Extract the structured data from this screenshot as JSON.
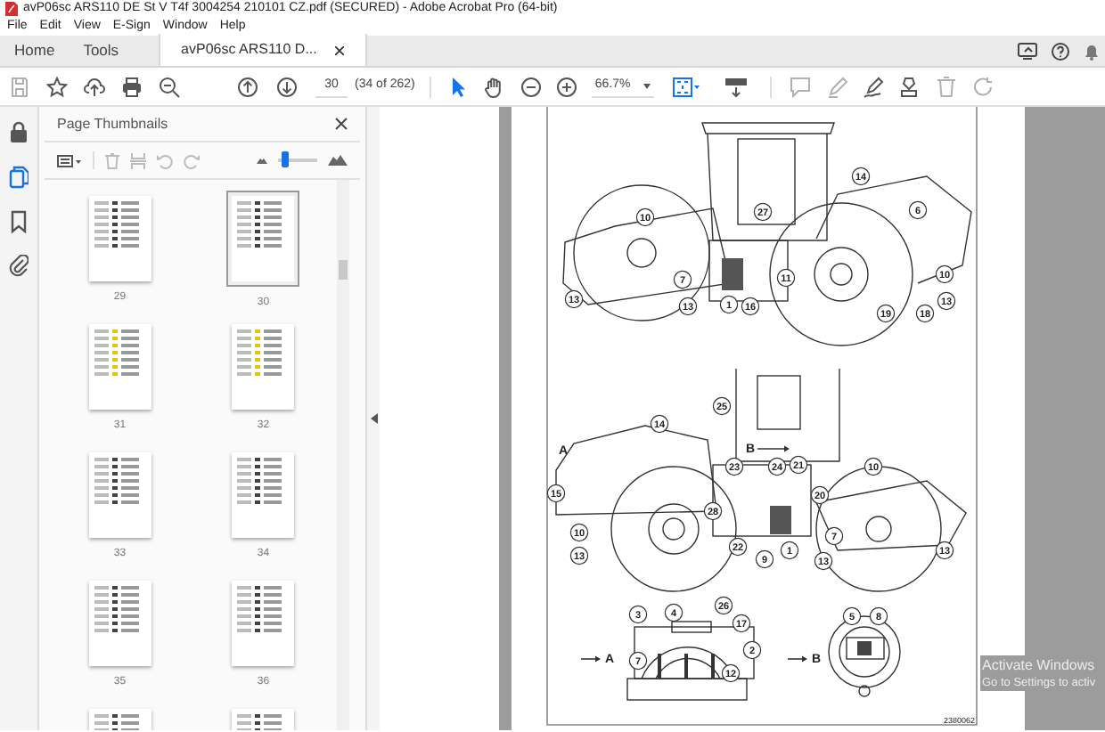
{
  "window": {
    "title": "avP06sc ARS110 DE St V T4f 3004254 210101 CZ.pdf (SECURED) - Adobe Acrobat Pro (64-bit)"
  },
  "menu": [
    "File",
    "Edit",
    "View",
    "E-Sign",
    "Window",
    "Help"
  ],
  "tabs": [
    {
      "label": "Home",
      "selected": false
    },
    {
      "label": "Tools",
      "selected": false
    },
    {
      "label": "avP06sc ARS110 D...",
      "selected": true
    }
  ],
  "toolbar": {
    "page_number": "30",
    "page_count": "(34 of 262)",
    "zoom": "66.7%"
  },
  "rail": [
    {
      "kind": "lock",
      "selected": false
    },
    {
      "kind": "pages",
      "selected": true
    },
    {
      "kind": "bookmark",
      "selected": false
    },
    {
      "kind": "attachment",
      "selected": false
    }
  ],
  "thumbnails_panel": {
    "title": "Page Thumbnails",
    "size_slider": {
      "level": 0.1
    },
    "pages": [
      {
        "label": "29",
        "selected": false
      },
      {
        "label": "30",
        "selected": true
      },
      {
        "label": "31",
        "selected": false
      },
      {
        "label": "32",
        "selected": false
      },
      {
        "label": "33",
        "selected": false
      },
      {
        "label": "34",
        "selected": false
      },
      {
        "label": "35",
        "selected": false
      },
      {
        "label": "36",
        "selected": false
      },
      {
        "selected": false
      },
      {
        "selected": false
      }
    ]
  },
  "document": {
    "callouts": [
      {
        "label": "10",
        "kind": "number"
      },
      {
        "label": "27",
        "kind": "number"
      },
      {
        "label": "14",
        "kind": "number"
      },
      {
        "label": "6",
        "kind": "number"
      },
      {
        "label": "7",
        "kind": "number"
      },
      {
        "label": "11",
        "kind": "number"
      },
      {
        "label": "13",
        "kind": "number"
      },
      {
        "label": "13",
        "kind": "number"
      },
      {
        "label": "1",
        "kind": "number"
      },
      {
        "label": "16",
        "kind": "number"
      },
      {
        "label": "10",
        "kind": "number"
      },
      {
        "label": "13",
        "kind": "number"
      },
      {
        "label": "19",
        "kind": "number"
      },
      {
        "label": "18",
        "kind": "number"
      },
      {
        "label": "25",
        "kind": "number"
      },
      {
        "label": "14",
        "kind": "number"
      },
      {
        "label": "A",
        "kind": "letter"
      },
      {
        "label": "B",
        "kind": "letter"
      },
      {
        "label": "23",
        "kind": "number"
      },
      {
        "label": "24",
        "kind": "number"
      },
      {
        "label": "21",
        "kind": "number"
      },
      {
        "label": "10",
        "kind": "number"
      },
      {
        "label": "15",
        "kind": "number"
      },
      {
        "label": "20",
        "kind": "number"
      },
      {
        "label": "28",
        "kind": "number"
      },
      {
        "label": "10",
        "kind": "number"
      },
      {
        "label": "7",
        "kind": "number"
      },
      {
        "label": "22",
        "kind": "number"
      },
      {
        "label": "9",
        "kind": "number"
      },
      {
        "label": "1",
        "kind": "number"
      },
      {
        "label": "13",
        "kind": "number"
      },
      {
        "label": "13",
        "kind": "number"
      },
      {
        "label": "13",
        "kind": "number"
      },
      {
        "label": "26",
        "kind": "number"
      },
      {
        "label": "3",
        "kind": "number"
      },
      {
        "label": "4",
        "kind": "number"
      },
      {
        "label": "17",
        "kind": "number"
      },
      {
        "label": "2",
        "kind": "number"
      },
      {
        "label": "A",
        "kind": "letter"
      },
      {
        "label": "7",
        "kind": "number"
      },
      {
        "label": "12",
        "kind": "number"
      },
      {
        "label": "B",
        "kind": "letter"
      },
      {
        "label": "5",
        "kind": "number"
      },
      {
        "label": "8",
        "kind": "number"
      }
    ],
    "figure_number": "2380062"
  },
  "os_notice": {
    "title": "Activate Windows",
    "subtitle": "Go to Settings to activ"
  }
}
